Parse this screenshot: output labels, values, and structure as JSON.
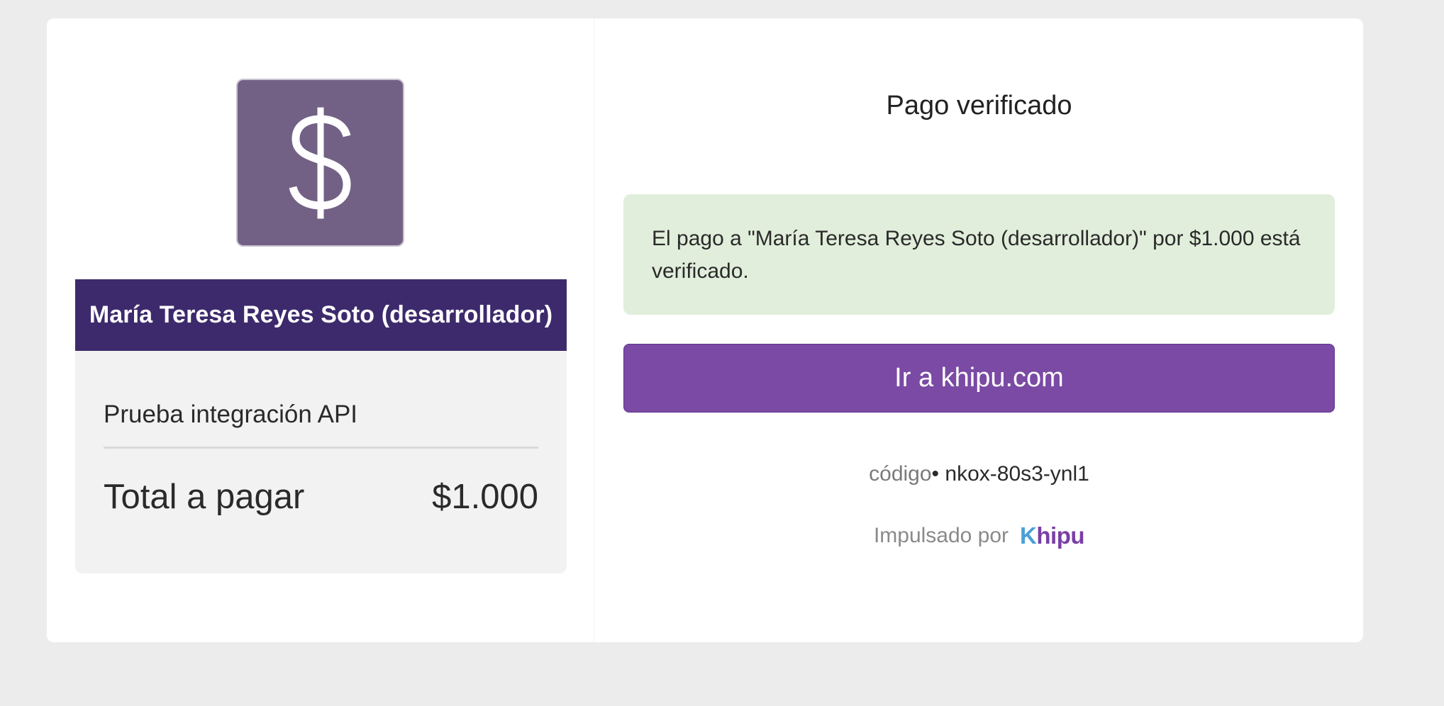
{
  "merchant": {
    "logo_icon": "dollar-sign-icon",
    "name": "María Teresa Reyes Soto (desarrollador)",
    "subject": "Prueba integración API",
    "total_label": "Total a pagar",
    "total_amount": "$1.000"
  },
  "status": {
    "title": "Pago verificado",
    "message": "El pago a \"María Teresa Reyes Soto (desarrollador)\" por $1.000 está verificado."
  },
  "cta": {
    "label": "Ir a khipu.com"
  },
  "code": {
    "label": "código",
    "separator": "•",
    "value": "nkox-80s3-ynl1"
  },
  "footer": {
    "powered_by": "Impulsado por",
    "brand_initial": "K",
    "brand_rest": "hipu"
  },
  "colors": {
    "banner": "#3d2a6c",
    "logo_bg": "#726185",
    "alert_bg": "#e1eedb",
    "button": "#7a4aa4",
    "brand_blue": "#4aa0d6",
    "brand_purple": "#7a3fa6"
  }
}
